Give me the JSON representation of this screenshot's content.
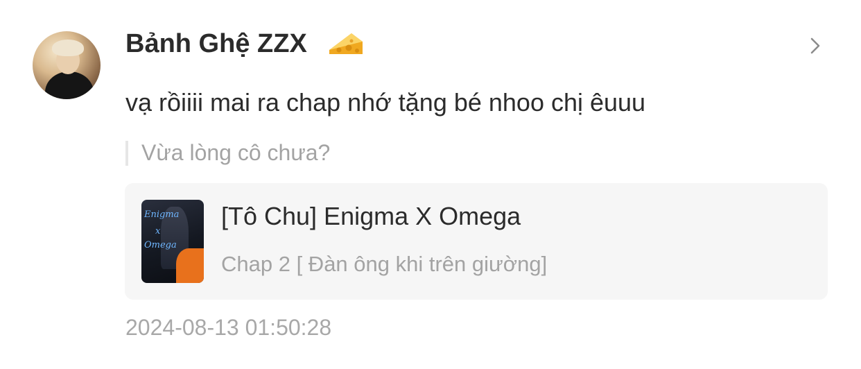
{
  "comment": {
    "username": "Bảnh Ghệ ZZX",
    "badge_icon": "cheese-icon",
    "text": "vạ rồiiii mai ra chap nhớ tặng bé nhoo chị êuuu",
    "quote": "Vừa lòng cô chưa?",
    "timestamp": "2024-08-13 01:50:28"
  },
  "card": {
    "title": "[Tô Chu] Enigma X Omega",
    "subtitle": "Chap 2 [ Đàn ông khi trên giường]",
    "cover_text_top": "Enigma",
    "cover_text_mid": "x",
    "cover_text_bottom": "Omega"
  },
  "colors": {
    "text_primary": "#2b2b2b",
    "text_secondary": "#a3a3a3",
    "card_bg": "#f6f6f6",
    "cheese": "#f5b935"
  }
}
